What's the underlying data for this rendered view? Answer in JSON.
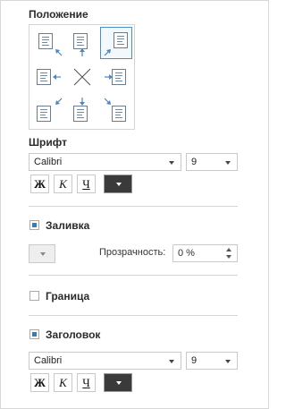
{
  "position": {
    "title": "Положение"
  },
  "font": {
    "title": "Шрифт",
    "family": "Calibri",
    "size": "9",
    "bold": "Ж",
    "italic": "К",
    "underline": "Ч"
  },
  "fill": {
    "label": "Заливка",
    "checked": true,
    "transparency_label": "Прозрачность:",
    "transparency_value": "0 %"
  },
  "border": {
    "label": "Граница",
    "checked": false
  },
  "header": {
    "label": "Заголовок",
    "checked": true,
    "family": "Calibri",
    "size": "9",
    "bold": "Ж",
    "italic": "К",
    "underline": "Ч"
  },
  "colors": {
    "accent": "#2f7fc0",
    "arrow": "#4a86c5",
    "font_color": "#3a3a3a"
  }
}
